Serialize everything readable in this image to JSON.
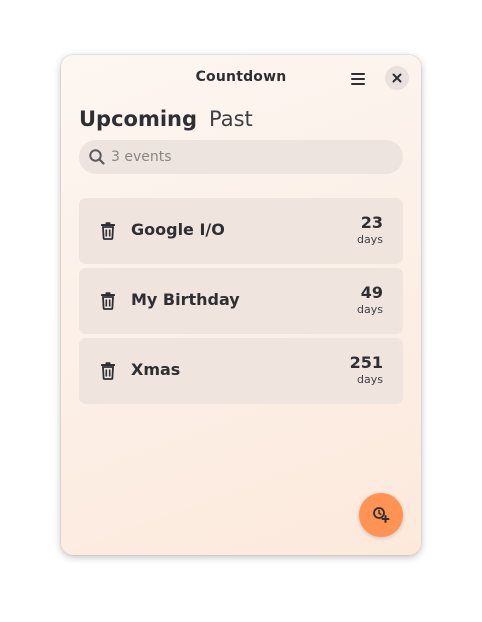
{
  "window": {
    "title": "Countdown"
  },
  "header": {
    "menu_icon": "hamburger-menu-icon",
    "close_icon": "close-icon"
  },
  "tabs": [
    {
      "label": "Upcoming",
      "active": true
    },
    {
      "label": "Past",
      "active": false
    }
  ],
  "search": {
    "placeholder": "3 events",
    "value": "",
    "icon": "search-icon"
  },
  "events": [
    {
      "name": "Google I/O",
      "count": "23",
      "unit": "days"
    },
    {
      "name": "My Birthday",
      "count": "49",
      "unit": "days"
    },
    {
      "name": "Xmas",
      "count": "251",
      "unit": "days"
    }
  ],
  "fab": {
    "icon": "add-event-icon",
    "color": "#ff9354"
  },
  "colors": {
    "accent": "#ff9354",
    "text": "#2e2e33",
    "row_bg": "#efe4de"
  }
}
